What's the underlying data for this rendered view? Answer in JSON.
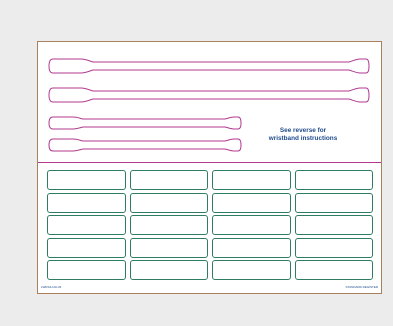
{
  "document": {
    "instructions": {
      "line1": "See reverse for",
      "line2": "wristband instructions"
    },
    "colors": {
      "page_background": "#ececec",
      "sheet_border": "#a9805c",
      "wristband_outline": "#b23a8f",
      "label_outline": "#2e7d63",
      "instruction_text": "#1e4a8c"
    },
    "wristbands": [
      {
        "name": "long-wristband"
      },
      {
        "name": "long-wristband"
      },
      {
        "name": "short-wristband"
      },
      {
        "name": "short-wristband"
      }
    ],
    "label_grid": {
      "columns": 4,
      "rows": 5
    },
    "footer": {
      "left": "LWDS4J-00-03",
      "right": "STANDARD REGISTER"
    }
  }
}
